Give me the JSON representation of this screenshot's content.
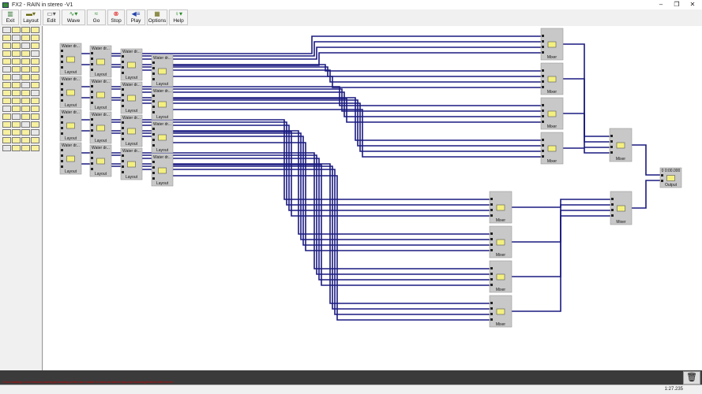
{
  "window": {
    "title": "FX2 - RAIN in stereo -V1",
    "controls": [
      "–",
      "❐",
      "✕"
    ]
  },
  "toolbar": [
    {
      "label": "Exit",
      "icon": "exit-icon",
      "glyph": "▥",
      "color": "#3a7a3a"
    },
    {
      "label": "Layout",
      "icon": "layout-icon",
      "glyph": "▬▾",
      "color": "#6a6a10"
    },
    {
      "label": "Edit",
      "icon": "edit-icon",
      "glyph": "▭▾",
      "color": "#555"
    },
    {
      "label": "Wave",
      "icon": "wave-icon",
      "glyph": "∿▾",
      "color": "#2a8a2a"
    },
    {
      "label": "Go",
      "icon": "go-icon",
      "glyph": "≈",
      "color": "#2a8a2a"
    },
    {
      "label": "Stop",
      "icon": "stop-icon",
      "glyph": "⊗",
      "color": "#d00"
    },
    {
      "label": "Play",
      "icon": "play-icon",
      "glyph": "◀≡",
      "color": "#2244aa"
    },
    {
      "label": "Options",
      "icon": "options-icon",
      "glyph": "▦",
      "color": "#6a6a10"
    },
    {
      "label": "Help",
      "icon": "help-icon",
      "glyph": "♀▾",
      "color": "#2a8a2a"
    }
  ],
  "modules": {
    "water_title": "Water dr...",
    "water_footer": "Layout",
    "mixer_footer": "Mixer",
    "output_title": "0 0:00.000",
    "output_footer": "Output"
  },
  "colors": {
    "wire": "#1a1a80",
    "node": "#c8c8c8",
    "icon": "#f4f080"
  },
  "status": {
    "time": "1:27.235",
    "log": "Error loading: out of memory during processing of the rain module in channel stereo layout processing finished with errors"
  }
}
